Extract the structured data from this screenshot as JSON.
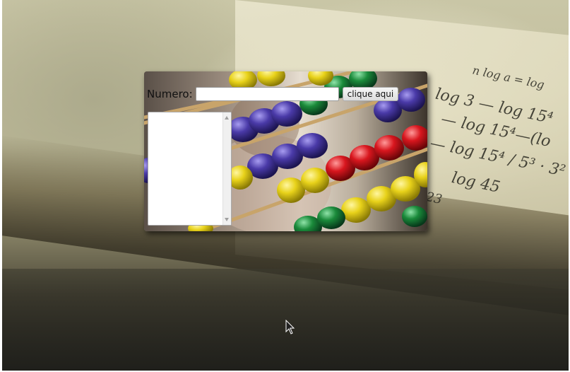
{
  "form": {
    "label": "Numero:",
    "input_value": "",
    "button_label": "clique aqui"
  },
  "list": {
    "items": []
  },
  "background": {
    "formulas": [
      "n log a = log",
      "log 3 — log 15⁴",
      "— log 15⁴—(lo",
      "— log 15⁴ / 5³ · 3²",
      "log 45",
      "23"
    ]
  },
  "colors": {
    "bead_yellow": "#e8d21a",
    "bead_blue": "#4a3aa8",
    "bead_red": "#d8161e",
    "bead_green": "#1a8a3a",
    "rod": "#c8a46a"
  },
  "icons": {
    "cursor": "mouse-pointer-icon",
    "scroll_up": "scroll-up-arrow-icon",
    "scroll_down": "scroll-down-arrow-icon"
  }
}
